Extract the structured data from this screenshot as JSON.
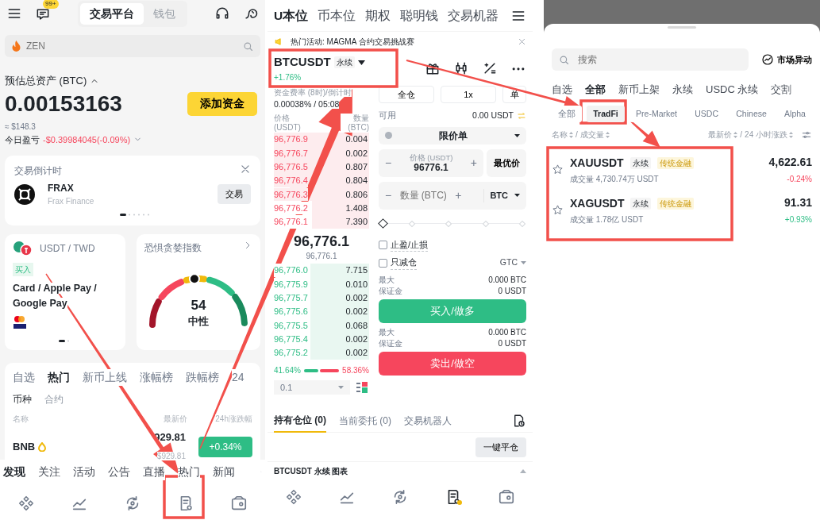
{
  "home": {
    "header": {
      "badge": "99+",
      "tabs": [
        {
          "label": "交易平台",
          "selected": true
        },
        {
          "label": "钱包",
          "selected": false
        }
      ]
    },
    "search": {
      "placeholder": "ZEN"
    },
    "assets": {
      "label": "预估总资产 (BTC)",
      "value": "0.00153163",
      "button": "添加资金",
      "fiat": "≈ $148.3",
      "pnl_label": "今日盈亏",
      "pnl": "-$0.39984045(-0.09%)"
    },
    "countdown": {
      "title": "交易倒计时",
      "name": "FRAX",
      "full_name": "Frax Finance",
      "button": "交易"
    },
    "buy_card": {
      "pair": "USDT / TWD",
      "tag": "买入",
      "methods": "Card / Apple Pay / Google Pay"
    },
    "fear_greed": {
      "title": "恐惧贪婪指数",
      "value": "54",
      "label": "中性"
    },
    "market": {
      "tabs": [
        {
          "label": "自选",
          "selected": false
        },
        {
          "label": "热门",
          "selected": true
        },
        {
          "label": "新币上线",
          "selected": false
        },
        {
          "label": "涨幅榜",
          "selected": false
        },
        {
          "label": "跌幅榜",
          "selected": false
        },
        {
          "label": "24",
          "selected": false
        }
      ],
      "subtabs": [
        {
          "label": "币种",
          "selected": true
        },
        {
          "label": "合约",
          "selected": false
        }
      ],
      "columns": [
        "名称",
        "最新价",
        "24h涨跌幅"
      ],
      "rows": [
        {
          "name": "BNB",
          "price": "929.81",
          "fiat": "$929.81",
          "change": "+0.34%",
          "color": "#2ebd85"
        }
      ]
    },
    "feed_tabs": [
      {
        "label": "发现",
        "selected": true
      },
      {
        "label": "关注",
        "selected": false
      },
      {
        "label": "活动",
        "selected": false
      },
      {
        "label": "公告",
        "selected": false
      },
      {
        "label": "直播",
        "selected": false
      },
      {
        "label": "热门",
        "selected": false
      },
      {
        "label": "新闻",
        "selected": false
      }
    ],
    "nav": [
      {
        "selected": false
      },
      {
        "selected": false
      },
      {
        "selected": false
      },
      {
        "selected": false
      },
      {
        "selected": false
      }
    ]
  },
  "futures": {
    "tabs": [
      {
        "label": "U本位",
        "selected": true
      },
      {
        "label": "币本位",
        "selected": false
      },
      {
        "label": "期权",
        "selected": false
      },
      {
        "label": "聪明钱",
        "selected": false
      },
      {
        "label": "交易机器",
        "selected": false
      }
    ],
    "banner": "热门活动: MAGMA 合约交易挑战赛",
    "symbol": "BTCUSDT",
    "contract": "永续",
    "change": "+1.76%",
    "funding_label": "资金费率 (8时)/倒计时",
    "funding": "0.00038% / 05:08",
    "book_columns": [
      "价格 (USDT)",
      "数量 (BTC)"
    ],
    "asks": [
      {
        "price": "96,776.9",
        "qty": "0.004"
      },
      {
        "price": "96,776.7",
        "qty": "0.002"
      },
      {
        "price": "96,776.5",
        "qty": "0.807"
      },
      {
        "price": "96,776.4",
        "qty": "0.804"
      },
      {
        "price": "96,776.3",
        "qty": "0.806"
      },
      {
        "price": "96,776.2",
        "qty": "1.408"
      },
      {
        "price": "96,776.1",
        "qty": "7.390"
      }
    ],
    "last_price": "96,776.1",
    "mark_price": "96,776.1",
    "bids": [
      {
        "price": "96,776.0",
        "qty": "7.715"
      },
      {
        "price": "96,775.9",
        "qty": "0.010"
      },
      {
        "price": "96,775.7",
        "qty": "0.002"
      },
      {
        "price": "96,775.6",
        "qty": "0.002"
      },
      {
        "price": "96,775.5",
        "qty": "0.068"
      },
      {
        "price": "96,775.4",
        "qty": "0.002"
      },
      {
        "price": "96,775.2",
        "qty": "0.002"
      }
    ],
    "ratio": {
      "buy": "41.64%",
      "sell": "58.36%",
      "level": 0.4164
    },
    "precision": "0.1",
    "margin_modes": [
      "全仓",
      "1x",
      "单"
    ],
    "available_label": "可用",
    "available": "0.00 USDT",
    "order_type": "限价单",
    "price_field": {
      "label": "价格 (USDT)",
      "value": "96776.1",
      "stepper": [
        "−",
        "+"
      ]
    },
    "best_price": "最优价",
    "qty_field": {
      "placeholder": "数量 (BTC)",
      "unit": "BTC",
      "stepper": [
        "−",
        "+"
      ]
    },
    "slider": {
      "level": 0
    },
    "checkboxes": [
      {
        "label": "止盈/止损",
        "checked": false
      },
      {
        "label": "只减仓",
        "checked": false
      }
    ],
    "tif": "GTC",
    "buy_info": [
      {
        "label": "最大",
        "value": "0.000 BTC"
      },
      {
        "label": "保证金",
        "value": "0 USDT"
      }
    ],
    "buy": "买入/做多",
    "sell_info": [
      {
        "label": "最大",
        "value": "0.000 BTC"
      },
      {
        "label": "保证金",
        "value": "0 USDT"
      }
    ],
    "sell": "卖出/做空",
    "position_tabs": [
      {
        "label": "持有仓位 (0)",
        "selected": true
      },
      {
        "label": "当前委托 (0)",
        "selected": false
      },
      {
        "label": "交易机器人",
        "selected": false
      }
    ],
    "close_all": "一键平仓",
    "chart_title": "BTCUSDT 永续 图表",
    "nav": [
      {
        "selected": false
      },
      {
        "selected": false
      },
      {
        "selected": false
      },
      {
        "selected": true
      },
      {
        "selected": false
      }
    ]
  },
  "sheet": {
    "search": {
      "placeholder": "搜索"
    },
    "alerts": "市场异动",
    "tabs": [
      {
        "label": "自选",
        "selected": false
      },
      {
        "label": "全部",
        "selected": true
      },
      {
        "label": "新币上架",
        "selected": false
      },
      {
        "label": "永续",
        "selected": false
      },
      {
        "label": "USDC 永续",
        "selected": false
      },
      {
        "label": "交割",
        "selected": false
      }
    ],
    "subtabs": [
      {
        "label": "全部",
        "selected": false
      },
      {
        "label": "TradFi",
        "selected": true
      },
      {
        "label": "Pre-Market",
        "selected": false
      },
      {
        "label": "USDC",
        "selected": false
      },
      {
        "label": "Chinese",
        "selected": false
      },
      {
        "label": "Alpha",
        "selected": false
      }
    ],
    "columns": [
      "名称",
      "成交量",
      "最新价",
      "24 小时涨跌"
    ],
    "separator": "/",
    "rows": [
      {
        "symbol": "XAUUSDT",
        "type": "永续",
        "tag": "传统金融",
        "volume": "成交量 4,730.74万 USDT",
        "price": "4,622.61",
        "change": "-0.24%",
        "color": "#f6465d",
        "favorite": false
      },
      {
        "symbol": "XAGUSDT",
        "type": "永续",
        "tag": "传统金融",
        "volume": "成交量 1.78亿 USDT",
        "price": "91.31",
        "change": "+0.93%",
        "color": "#2ebd85",
        "favorite": false
      }
    ]
  }
}
